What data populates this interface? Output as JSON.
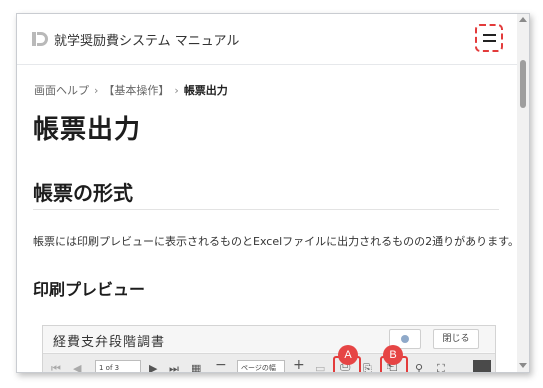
{
  "header": {
    "app_title": "就学奨励費システム マニュアル",
    "logo_icon": "app-logo-icon",
    "menu_icon": "hamburger-menu-icon"
  },
  "breadcrumb": {
    "items": [
      "画面ヘルプ",
      "【基本操作】",
      "帳票出力"
    ],
    "separator": "›"
  },
  "page_title": "帳票出力",
  "section": {
    "title": "帳票の形式",
    "body": "帳票には印刷プレビューに表示されるものとExcelファイルに出力されるものの2通りがあります。"
  },
  "subsection": {
    "title": "印刷プレビュー"
  },
  "screenshot": {
    "title": "経費支弁段階調書",
    "close_label": "閉じる",
    "page_value": "1 of 3",
    "zoom_value": "ページの幅",
    "markers": [
      "A",
      "B"
    ],
    "toolbar_icons": {
      "first": "⏮",
      "prev": "◀",
      "next": "▶",
      "last": "⏭",
      "thumbnails": "▦",
      "zoom_out": "−",
      "zoom_in": "+",
      "print": "⎙",
      "export": "⎗",
      "search": "⚲",
      "fullscreen": "⛶"
    }
  },
  "colors": {
    "highlight": "#e33b3b",
    "marker": "#e64545",
    "text": "#2b2b2b"
  }
}
